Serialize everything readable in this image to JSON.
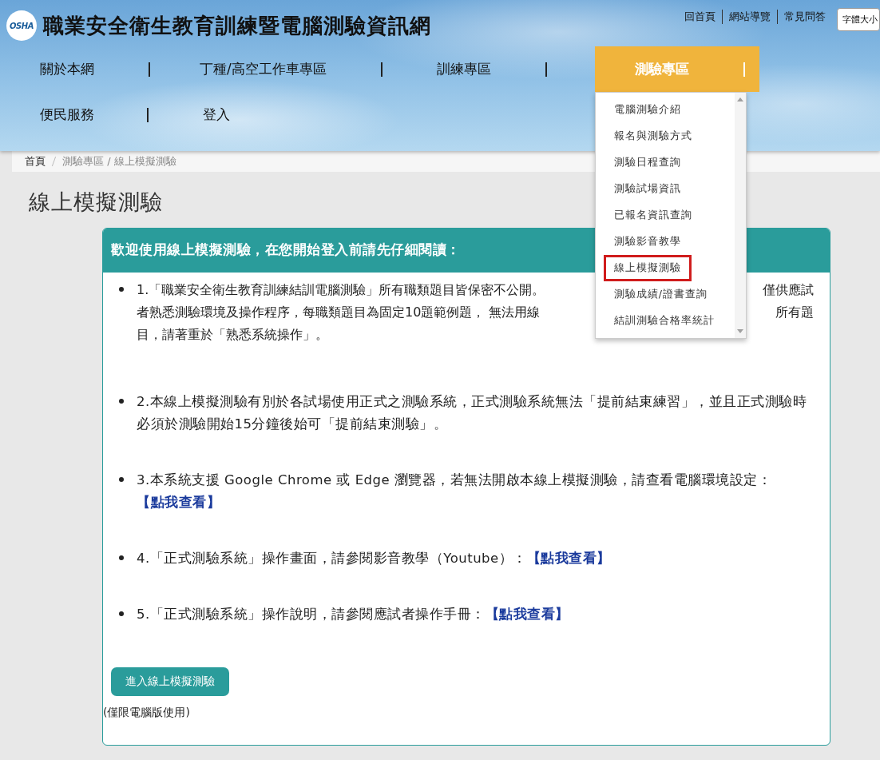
{
  "header": {
    "logo_text": "OSHA",
    "site_title": "職業安全衛生教育訓練暨電腦測驗資訊網",
    "top_links": [
      "回首頁",
      "網站導覽",
      "常見問答"
    ],
    "font_size_select": {
      "value": "字體大小"
    }
  },
  "nav": {
    "items": [
      {
        "label": "關於本網",
        "selected": false
      },
      {
        "label": "丁種/高空工作車專區",
        "selected": false
      },
      {
        "label": "訓練專區",
        "selected": false
      },
      {
        "label": "測驗專區",
        "selected": true
      },
      {
        "label": "便民服務",
        "selected": false
      },
      {
        "label": "登入",
        "selected": false
      }
    ],
    "dropdown": {
      "items": [
        {
          "label": "電腦測驗介紹",
          "selected": false
        },
        {
          "label": "報名與測驗方式",
          "selected": false
        },
        {
          "label": "測驗日程查詢",
          "selected": false
        },
        {
          "label": "測驗試場資訊",
          "selected": false
        },
        {
          "label": "已報名資訊查詢",
          "selected": false
        },
        {
          "label": "測驗影音教學",
          "selected": false
        },
        {
          "label": "線上模擬測驗",
          "selected": true
        },
        {
          "label": "測驗成績/證書查詢",
          "selected": false
        },
        {
          "label": "結訓測驗合格率統計",
          "selected": false
        }
      ]
    }
  },
  "breadcrumb": [
    "首頁",
    "測驗專區 / 線上模擬測驗"
  ],
  "page_title": "線上模擬測驗",
  "notice": {
    "heading": "歡迎使用線上模擬測驗，在您開始登入前請先仔細閱讀：",
    "items": [
      {
        "lines": [
          [
            "1.「職業安全衛生教育訓練結訓電腦測驗」所有職類題目皆保密不公開。",
            "僅供應試"
          ],
          [
            "者熟悉測驗環境及操作程序，每職類題目為固定10題範例題， 無法用線",
            "所有題"
          ],
          [
            "目，請著重於「熟悉系統操作」。"
          ]
        ]
      },
      {
        "text": "2.本線上模擬測驗有別於各試場使用正式之測驗系統，正式測驗系統無法「提前結束練習」，並且正式測驗時必須於測驗開始15分鐘後始可「提前結束測驗」。"
      },
      {
        "text": "3.本系統支援 Google Chrome 或 Edge 瀏覽器，若無法開啟本線上模擬測驗，請查看電腦環境設定：",
        "link": "【點我查看】"
      },
      {
        "text": "4.「正式測驗系統」操作畫面，請參閱影音教學（Youtube）：",
        "link": "【點我查看】"
      },
      {
        "text": "5.「正式測驗系統」操作說明，請參閱應試者操作手冊：",
        "link": "【點我查看】"
      }
    ],
    "button": "進入線上模擬測驗",
    "note": "(僅限電腦版使用)"
  }
}
